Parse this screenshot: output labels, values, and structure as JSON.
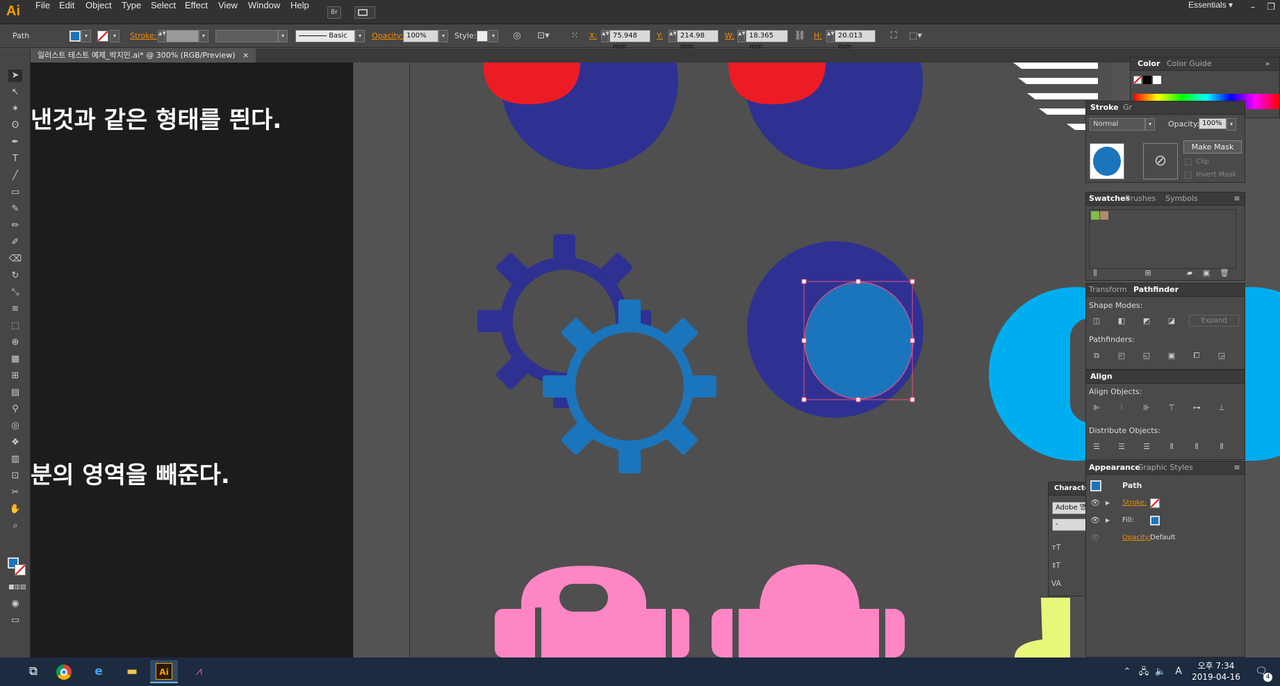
{
  "app": {
    "logo": "Ai",
    "workspace": "Essentials",
    "menu": [
      "File",
      "Edit",
      "Object",
      "Type",
      "Select",
      "Effect",
      "View",
      "Window",
      "Help"
    ],
    "bridge": "Br"
  },
  "control": {
    "selection": "Path",
    "stroke_label": "Stroke:",
    "stroke_style": "Basic",
    "opacity_label": "Opacity:",
    "opacity": "100%",
    "style_label": "Style:",
    "x_label": "X:",
    "x": "75.948 mm",
    "y_label": "Y:",
    "y": "214.98 mm",
    "w_label": "W:",
    "w": "18.365 mm",
    "h_label": "H:",
    "h": "20.013 mm"
  },
  "document": {
    "tab": "일러스트 테스트 예제_박지민.ai* @ 300% (RGB/Preview)",
    "close": "×"
  },
  "canvas": {
    "text1": "낸것과 같은 형태를 띈다.",
    "text2": "분의 영역을 빼준다."
  },
  "colors": {
    "red": "#ed1c24",
    "navy": "#2e3192",
    "blue": "#1b75bc",
    "pink": "#ff86c5",
    "cyan": "#00aeef",
    "yellow": "#e8f77a",
    "selection": "#ef4f79"
  },
  "panels": {
    "color": {
      "tabs": [
        "Color",
        "Color Guide"
      ]
    },
    "transparency": {
      "tabs": [
        "Stroke",
        "Gr"
      ],
      "blend": "Normal",
      "opacity_label": "Opacity:",
      "opacity": "100%",
      "make_mask": "Make Mask",
      "clip": "Clip",
      "invert": "Invert Mask"
    },
    "swatches": {
      "tabs": [
        "Swatches",
        "Brushes",
        "Symbols"
      ]
    },
    "pathfinder": {
      "tabs": [
        "Transform",
        "Pathfinder"
      ],
      "shape_modes": "Shape Modes:",
      "expand": "Expand",
      "pathfinders": "Pathfinders:"
    },
    "align": {
      "title": "Align",
      "objects": "Align Objects:",
      "distribute": "Distribute Objects:"
    },
    "appearance": {
      "tabs": [
        "Appearance",
        "Graphic Styles"
      ],
      "item": "Path",
      "stroke": "Stroke:",
      "fill": "Fill:",
      "opacity": "Opacity:",
      "opacity_val": "Default"
    },
    "character": {
      "title": "Characte",
      "font": "Adobe 명",
      "style": "-"
    }
  },
  "taskbar": {
    "time": "오후 7:34",
    "date": "2019-04-16",
    "ime": "A",
    "badge": "4"
  }
}
